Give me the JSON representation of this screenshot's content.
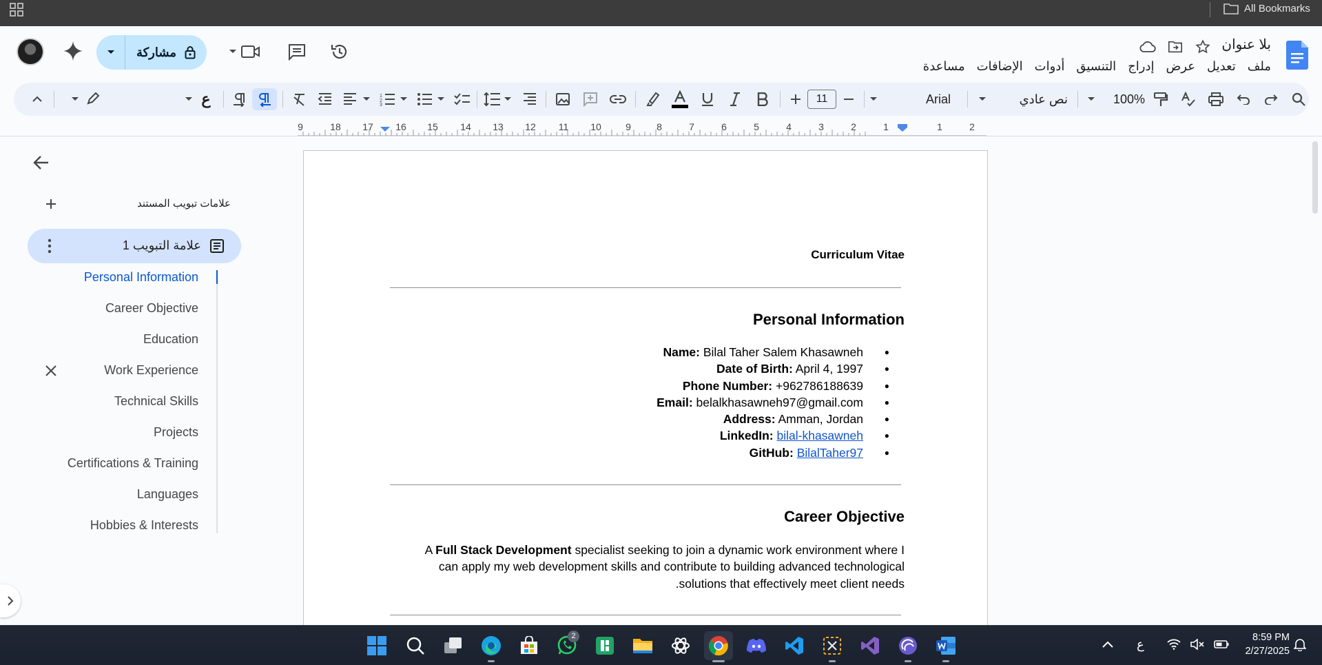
{
  "browser": {
    "bookmarks_label": "All Bookmarks"
  },
  "header": {
    "doc_title": "بلا عنوان",
    "menu": [
      "ملف",
      "تعديل",
      "عرض",
      "إدراج",
      "التنسيق",
      "أدوات",
      "الإضافات",
      "مساعدة"
    ],
    "share_label": "مشاركة"
  },
  "toolbar": {
    "zoom": "100%",
    "style": "نص عادي",
    "font": "Arial",
    "font_size": "11",
    "lang_glyph": "ع"
  },
  "ruler": {
    "labels": [
      "2",
      "1",
      "1",
      "2",
      "3",
      "4",
      "5",
      "6",
      "7",
      "8",
      "9",
      "10",
      "11",
      "12",
      "13",
      "14",
      "15",
      "16",
      "17",
      "18",
      "9"
    ]
  },
  "sidebar": {
    "tabs_header": "علامات تبويب المستند",
    "tab_label": "علامة التبويب 1",
    "outline": [
      "Personal Information",
      "Career Objective",
      "Education",
      "Work Experience",
      "Technical Skills",
      "Projects",
      "Certifications & Training",
      "Languages",
      "Hobbies & Interests"
    ]
  },
  "document": {
    "title": "Curriculum Vitae",
    "section1": "Personal Information",
    "info": [
      {
        "label": "Name:",
        "value": " Bilal Taher Salem Khasawneh"
      },
      {
        "label": "Date of Birth:",
        "value": " April 4, 1997"
      },
      {
        "label": "Phone Number:",
        "value": " +962786188639"
      },
      {
        "label": "Email:",
        "value": " belalkhasawneh97@gmail.com"
      },
      {
        "label": "Address:",
        "value": " Amman, Jordan"
      },
      {
        "label": "LinkedIn:",
        "link": "bilal-khasawneh"
      },
      {
        "label": "GitHub:",
        "link": "BilalTaher97"
      }
    ],
    "section2": "Career Objective",
    "objective": {
      "pre": "A ",
      "bold": "Full Stack Development",
      "line1_rest": " specialist seeking to join a dynamic work environment where I",
      "line2": "can apply my web development skills and contribute to building advanced technological",
      "line3": ".solutions that effectively meet client needs"
    }
  },
  "taskbar": {
    "whatsapp_badge": "2",
    "lang": "ع",
    "time": "8:59 PM",
    "date": "2/27/2025"
  }
}
